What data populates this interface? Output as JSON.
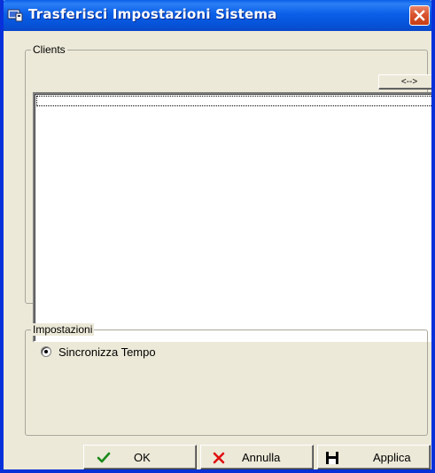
{
  "window": {
    "title": "Trasferisci Impostazioni Sistema",
    "title_bar_color": "#0a5fe8",
    "close_icon": "close-icon"
  },
  "clients": {
    "group_label": "Clients",
    "swap_button_label": "<-->",
    "list_items": []
  },
  "settings": {
    "group_label": "Impostazioni",
    "option_label": "Sincronizza Tempo",
    "option_selected": true
  },
  "buttons": {
    "ok_label": "OK",
    "ok_icon": "checkmark-icon",
    "cancel_label": "Annulla",
    "cancel_icon": "x-icon",
    "apply_label": "Applica",
    "apply_icon": "floppy-disk-icon"
  },
  "colors": {
    "dialog_background": "#ece9d8",
    "ok_icon": "#1a8a1a",
    "cancel_icon": "#e01010"
  }
}
